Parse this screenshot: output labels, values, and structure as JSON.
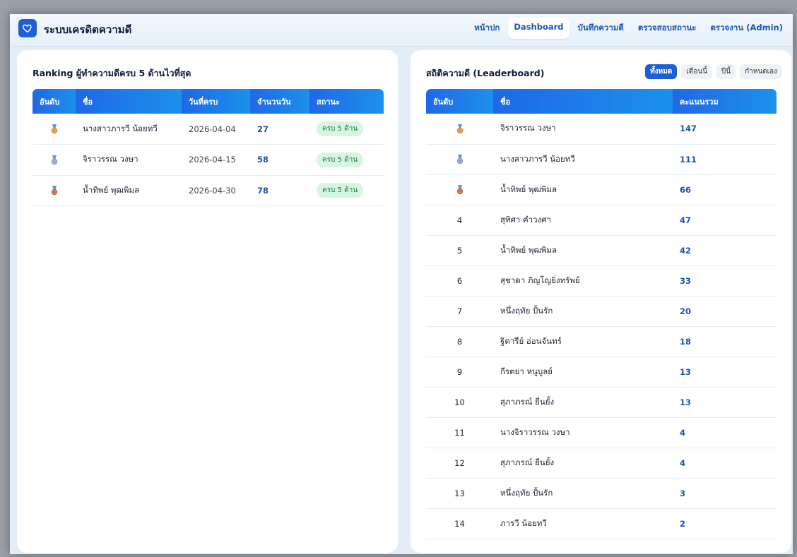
{
  "app": {
    "title": "ระบบเครดิตความดี"
  },
  "nav": [
    {
      "label": "หน้าปก",
      "active": false
    },
    {
      "label": "Dashboard",
      "active": true
    },
    {
      "label": "บันทึกความดี",
      "active": false
    },
    {
      "label": "ตรวจสอบสถานะ",
      "active": false
    },
    {
      "label": "ตรวจงาน (Admin)",
      "active": false
    }
  ],
  "ranking": {
    "title": "Ranking ผู้ทำความดีครบ 5 ด้านไวที่สุด",
    "headers": [
      "อันดับ",
      "ชื่อ",
      "วันที่ครบ",
      "จำนวนวัน",
      "สถานะ"
    ],
    "rows": [
      {
        "medal": "gold-medal-icon",
        "name": "นางสาวภารวี น้อยทวี",
        "date": "2026-04-04",
        "days": "27",
        "status": "ครบ 5 ด้าน"
      },
      {
        "medal": "silver-medal-icon",
        "name": "จิราวรรณ วงษา",
        "date": "2026-04-15",
        "days": "58",
        "status": "ครบ 5 ด้าน"
      },
      {
        "medal": "bronze-medal-icon",
        "name": "น้ำทิพย์ พุฒพิมล",
        "date": "2026-04-30",
        "days": "78",
        "status": "ครบ 5 ด้าน"
      }
    ]
  },
  "leaderboard": {
    "title": "สถิติความดี (Leaderboard)",
    "filters": [
      {
        "label": "ทั้งหมด",
        "active": true
      },
      {
        "label": "เดือนนี้",
        "active": false
      },
      {
        "label": "ปีนี้",
        "active": false
      },
      {
        "label": "กำหนดเอง",
        "active": false
      }
    ],
    "headers": [
      "อันดับ",
      "ชื่อ",
      "คะแนนรวม"
    ],
    "rows": [
      {
        "rank": "",
        "medal": "gold-medal-icon",
        "name": "จิราวรรณ วงษา",
        "score": "147"
      },
      {
        "rank": "",
        "medal": "silver-medal-icon",
        "name": "นางสาวภารวี น้อยทวี",
        "score": "111"
      },
      {
        "rank": "",
        "medal": "bronze-medal-icon",
        "name": "น้ำทิพย์ พุฒพิมล",
        "score": "66"
      },
      {
        "rank": "4",
        "medal": "",
        "name": "สุทิศา คำวงศา",
        "score": "47"
      },
      {
        "rank": "5",
        "medal": "",
        "name": "น้ำทิพย์ พุฒพิมล",
        "score": "42"
      },
      {
        "rank": "6",
        "medal": "",
        "name": "สุชาดา ภิญโญยิ่งทรัพย์",
        "score": "33"
      },
      {
        "rank": "7",
        "medal": "",
        "name": "หนึ่งฤทัย ปั้นรัก",
        "score": "20"
      },
      {
        "rank": "8",
        "medal": "",
        "name": "ฐิตารีย์ อ่อนจันทร์",
        "score": "18"
      },
      {
        "rank": "9",
        "medal": "",
        "name": "กีรตยา หนูบูลย์",
        "score": "13"
      },
      {
        "rank": "10",
        "medal": "",
        "name": "สุภาภรณ์ ยืนยั้ง",
        "score": "13"
      },
      {
        "rank": "11",
        "medal": "",
        "name": "นางจิราวรรณ วงษา",
        "score": "4"
      },
      {
        "rank": "12",
        "medal": "",
        "name": "สุภาภรณ์ ยืนยั้ง",
        "score": "4"
      },
      {
        "rank": "13",
        "medal": "",
        "name": "หนึ่งฤทัย ปั้นรัก",
        "score": "3"
      },
      {
        "rank": "14",
        "medal": "",
        "name": "ภารวี น้อยทวี",
        "score": "2"
      }
    ]
  },
  "colors": {
    "primary": "#1e5fd6",
    "gold": "#d98a2b",
    "silver": "#8b97c9",
    "bronze": "#b5663a",
    "ribbon": "#6b8fe0"
  }
}
